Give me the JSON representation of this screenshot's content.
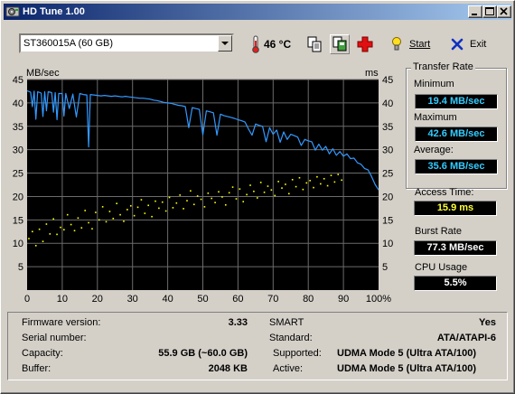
{
  "window": {
    "title": "HD Tune 1.00"
  },
  "toolbar": {
    "drive_selected": "ST360015A (60 GB)",
    "temperature": "46 °C",
    "start_label": "Start",
    "exit_label": "Exit"
  },
  "chart": {
    "y_unit_left": "MB/sec",
    "y_unit_right": "ms"
  },
  "chart_data": {
    "type": "line",
    "x_ticks": [
      "0",
      "10",
      "20",
      "30",
      "40",
      "50",
      "60",
      "70",
      "80",
      "90",
      "100%"
    ],
    "y_ticks": [
      "5",
      "10",
      "15",
      "20",
      "25",
      "30",
      "35",
      "40",
      "45"
    ],
    "xlim": [
      0,
      100
    ],
    "ylim_left": [
      0,
      45
    ],
    "ylim_right": [
      0,
      45
    ],
    "grid": true,
    "series": [
      {
        "unit": "MB/sec",
        "color": "#3399ff",
        "x": [
          0,
          1,
          1.5,
          2,
          2.5,
          3,
          4,
          4.5,
          5,
          5.5,
          6,
          7,
          7.5,
          8,
          8.5,
          9,
          10,
          10.5,
          11,
          12,
          13,
          14,
          15,
          16,
          17,
          17.5,
          18,
          19,
          20,
          21,
          22,
          23,
          24,
          25,
          26,
          27,
          28,
          29,
          30,
          31,
          32,
          33,
          34,
          35,
          36,
          37,
          38,
          39,
          40,
          41,
          42,
          43,
          44,
          45,
          46,
          47,
          48,
          49,
          50,
          51,
          52,
          53,
          54,
          55,
          56,
          57,
          58,
          59,
          60,
          61,
          62,
          63,
          64,
          65,
          66,
          67,
          68,
          69,
          70,
          71,
          72,
          73,
          74,
          75,
          76,
          77,
          78,
          79,
          80,
          81,
          82,
          83,
          84,
          85,
          86,
          87,
          88,
          89,
          90,
          91,
          92,
          93,
          94,
          95,
          96,
          97,
          98,
          99,
          100
        ],
        "y": [
          42.6,
          42.3,
          39.2,
          42.5,
          36.5,
          42.4,
          42.1,
          37.1,
          42.4,
          38.3,
          42.4,
          42.2,
          38.0,
          42.2,
          36.4,
          42.0,
          42.0,
          37.2,
          42.0,
          38.8,
          41.9,
          37.0,
          42.0,
          41.8,
          41.7,
          30.6,
          41.8,
          41.7,
          41.6,
          41.5,
          41.6,
          41.5,
          41.4,
          41.5,
          41.4,
          41.3,
          41.4,
          41.3,
          41.2,
          41.1,
          41.0,
          41.0,
          40.9,
          40.8,
          40.6,
          40.5,
          40.3,
          40.1,
          40.0,
          39.9,
          39.7,
          39.5,
          39.4,
          39.2,
          34.7,
          39.0,
          38.8,
          38.6,
          33.2,
          38.3,
          38.1,
          37.9,
          33.1,
          37.6,
          37.3,
          37.1,
          36.9,
          36.7,
          36.4,
          36.2,
          35.9,
          34.4,
          33.1,
          35.5,
          35.2,
          35.0,
          31.7,
          34.7,
          33.3,
          34.2,
          31.6,
          33.8,
          32.2,
          33.3,
          33.0,
          32.7,
          30.9,
          32.2,
          31.9,
          31.7,
          29.9,
          31.2,
          29.9,
          30.7,
          29.1,
          30.2,
          28.8,
          29.6,
          28.6,
          29.1,
          28.1,
          28.2,
          27.2,
          26.9,
          26.0,
          25.7,
          24.3,
          22.6,
          21.4
        ]
      },
      {
        "unit": "ms",
        "color": "#ffff00",
        "style": "scatter",
        "x": [
          0.5,
          1.5,
          2.5,
          3.5,
          4.5,
          5.5,
          6.5,
          7.5,
          8.5,
          9.5,
          10.5,
          11.5,
          12.5,
          13.5,
          14.5,
          15.5,
          16.5,
          17.5,
          18.5,
          19.5,
          20.5,
          21.5,
          22.5,
          23.5,
          24.5,
          25.5,
          26.5,
          27.5,
          28.5,
          29.5,
          30.5,
          31.5,
          32.5,
          33.5,
          34.5,
          35.5,
          36.5,
          37.5,
          38.5,
          39.5,
          40.5,
          41.5,
          42.5,
          43.5,
          44.5,
          45.5,
          46.5,
          47.5,
          48.5,
          49.5,
          50.5,
          51.5,
          52.5,
          53.5,
          54.5,
          55.5,
          56.5,
          57.5,
          58.5,
          59.5,
          60.5,
          61.5,
          62.5,
          63.5,
          64.5,
          65.5,
          66.5,
          67.5,
          68.5,
          69.5,
          70.5,
          71.5,
          72.5,
          73.5,
          74.5,
          75.5,
          76.5,
          77.5,
          78.5,
          79.5,
          80.5,
          81.5,
          82.5,
          83.5,
          84.5,
          85.5,
          86.5,
          87.5,
          88.5,
          89.5
        ],
        "y": [
          11.0,
          12.5,
          9.5,
          13.0,
          10.4,
          14.1,
          12.0,
          15.2,
          11.9,
          13.4,
          12.9,
          16.1,
          14.0,
          12.7,
          15.4,
          13.3,
          17.0,
          14.4,
          13.1,
          16.6,
          15.0,
          17.8,
          14.6,
          16.8,
          15.3,
          18.5,
          16.1,
          14.7,
          17.2,
          18.0,
          15.9,
          17.7,
          19.3,
          16.4,
          18.1,
          15.7,
          19.0,
          17.5,
          18.8,
          16.9,
          19.8,
          17.6,
          18.6,
          20.3,
          17.4,
          19.1,
          21.2,
          18.3,
          20.1,
          19.4,
          17.8,
          20.7,
          19.6,
          18.7,
          21.0,
          19.9,
          18.2,
          20.8,
          22.0,
          19.5,
          21.6,
          18.9,
          20.4,
          22.4,
          21.1,
          19.7,
          23.0,
          20.9,
          22.2,
          21.4,
          20.2,
          23.2,
          21.8,
          22.6,
          20.6,
          23.6,
          22.1,
          24.0,
          21.5,
          22.9,
          23.4,
          21.9,
          24.2,
          22.7,
          23.8,
          22.3,
          24.5,
          23.1,
          24.7,
          23.5
        ]
      }
    ]
  },
  "transfer_rate": {
    "title": "Transfer Rate",
    "minimum_label": "Minimum",
    "minimum_value": "19.4 MB/sec",
    "maximum_label": "Maximum",
    "maximum_value": "42.6 MB/sec",
    "average_label": "Average:",
    "average_value": "35.6 MB/sec"
  },
  "access_time": {
    "label": "Access Time:",
    "value": "15.9 ms"
  },
  "burst_rate": {
    "label": "Burst Rate",
    "value": "77.3 MB/sec"
  },
  "cpu_usage": {
    "label": "CPU Usage",
    "value": "5.5%"
  },
  "info": {
    "firmware_label": "Firmware version:",
    "firmware_value": "3.33",
    "serial_label": "Serial number:",
    "serial_value": "",
    "capacity_label": "Capacity:",
    "capacity_value": "55.9 GB (~60.0 GB)",
    "buffer_label": "Buffer:",
    "buffer_value": "2048 KB",
    "smart_label": "SMART",
    "smart_value": "Yes",
    "standard_label": "Standard:",
    "standard_value": "ATA/ATAPI-6",
    "supported_label": "Supported:",
    "supported_value": "UDMA Mode 5 (Ultra ATA/100)",
    "active_label": "Active:",
    "active_value": "UDMA Mode 5 (Ultra ATA/100)"
  },
  "colors": {
    "titlebar_start": "#0a246a",
    "chart_bg": "#000000",
    "grid": "#6b6b6b",
    "transfer_line": "#3399ff",
    "access_dots": "#ffff00",
    "value_cyan": "#33ccff",
    "value_yellow": "#ffff33",
    "value_white": "#ffffff"
  },
  "icons": {
    "app": "hdtune-app-icon",
    "thermometer": "thermometer-icon",
    "copy": "copy-icon",
    "save": "save-copy-icon",
    "health": "red-cross-icon",
    "start": "lightbulb-icon",
    "exit": "blue-x-icon"
  }
}
